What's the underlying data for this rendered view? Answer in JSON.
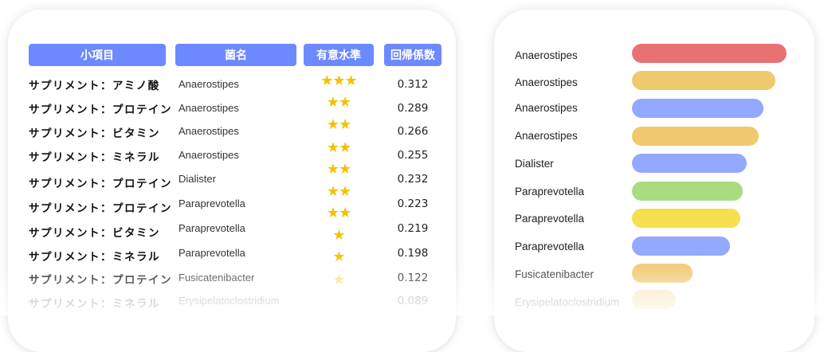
{
  "table": {
    "headers": [
      "小項目",
      "菌名",
      "有意水準",
      "回帰係数"
    ],
    "rows": [
      {
        "item": "サプリメント：アミノ酸",
        "genus": "Anaerostipes",
        "stars": "★★★",
        "coef": "0.312"
      },
      {
        "item": "サプリメント：プロテイン",
        "genus": "Anaerostipes",
        "stars": "★★",
        "coef": "0.289"
      },
      {
        "item": "サプリメント：ビタミン",
        "genus": "Anaerostipes",
        "stars": "★★",
        "coef": "0.266"
      },
      {
        "item": "サプリメント：ミネラル",
        "genus": "Anaerostipes",
        "stars": "★★",
        "coef": "0.255"
      },
      {
        "item": "サプリメント：プロテイン",
        "genus": "Dialister",
        "stars": "★★",
        "coef": "0.232"
      },
      {
        "item": "サプリメント：プロテイン",
        "genus": "Paraprevotella",
        "stars": "★★",
        "coef": "0.223"
      },
      {
        "item": "サプリメント：ビタミン",
        "genus": "Paraprevotella",
        "stars": "★★",
        "coef": "0.219"
      },
      {
        "item": "サプリメント：ミネラル",
        "genus": "Paraprevotella",
        "stars": "★",
        "coef": "0.198"
      },
      {
        "item": "サプリメント：プロテイン",
        "genus": "Fusicatenibacter",
        "stars": "★",
        "coef": "0.122"
      },
      {
        "item": "サプリメント：ミネラル",
        "genus": "Erysipelatoclostridium",
        "stars": "★",
        "coef": "0.089"
      }
    ]
  },
  "chart_data": {
    "type": "bar",
    "orientation": "horizontal",
    "categories": [
      "Anaerostipes",
      "Anaerostipes",
      "Anaerostipes",
      "Anaerostipes",
      "Dialister",
      "Paraprevotella",
      "Paraprevotella",
      "Paraprevotella",
      "Fusicatenibacter",
      "Erysipelatoclostridium"
    ],
    "values": [
      0.312,
      0.289,
      0.266,
      0.255,
      0.232,
      0.223,
      0.219,
      0.198,
      0.122,
      0.089
    ],
    "colors": [
      "#e87272",
      "#f0c86e",
      "#93a8ff",
      "#f0c86e",
      "#93a8ff",
      "#a8dc7e",
      "#f5e04e",
      "#93a8ff",
      "#f0c86e",
      "#f0c86e"
    ],
    "xlim": [
      0,
      0.312
    ],
    "title": "",
    "xlabel": "",
    "ylabel": "",
    "grid": false
  }
}
